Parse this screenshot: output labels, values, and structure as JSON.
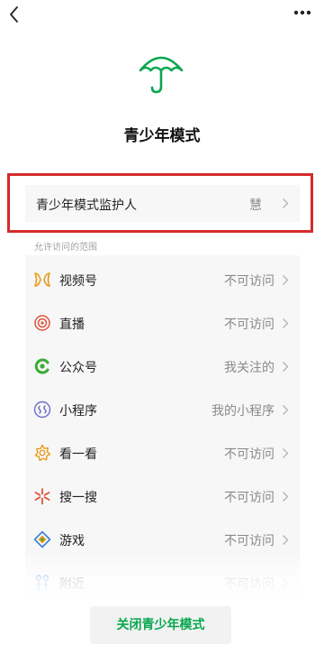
{
  "title": "青少年模式",
  "guardian": {
    "label": "青少年模式监护人",
    "value": "慧"
  },
  "section_header": "允许访问的范围",
  "access_items": [
    {
      "label": "视频号",
      "value": "不可访问",
      "icon": "video-channel-icon"
    },
    {
      "label": "直播",
      "value": "不可访问",
      "icon": "live-icon"
    },
    {
      "label": "公众号",
      "value": "我关注的",
      "icon": "official-account-icon"
    },
    {
      "label": "小程序",
      "value": "我的小程序",
      "icon": "mini-program-icon"
    },
    {
      "label": "看一看",
      "value": "不可访问",
      "icon": "top-stories-icon"
    },
    {
      "label": "搜一搜",
      "value": "不可访问",
      "icon": "search-icon"
    },
    {
      "label": "游戏",
      "value": "不可访问",
      "icon": "games-icon"
    },
    {
      "label": "附近",
      "value": "不可访问",
      "icon": "nearby-icon"
    }
  ],
  "close_button": "关闭青少年模式",
  "colors": {
    "accent_green": "#07a74f",
    "highlight_red": "#d42b2b",
    "row_background": "#f7f7f7"
  }
}
